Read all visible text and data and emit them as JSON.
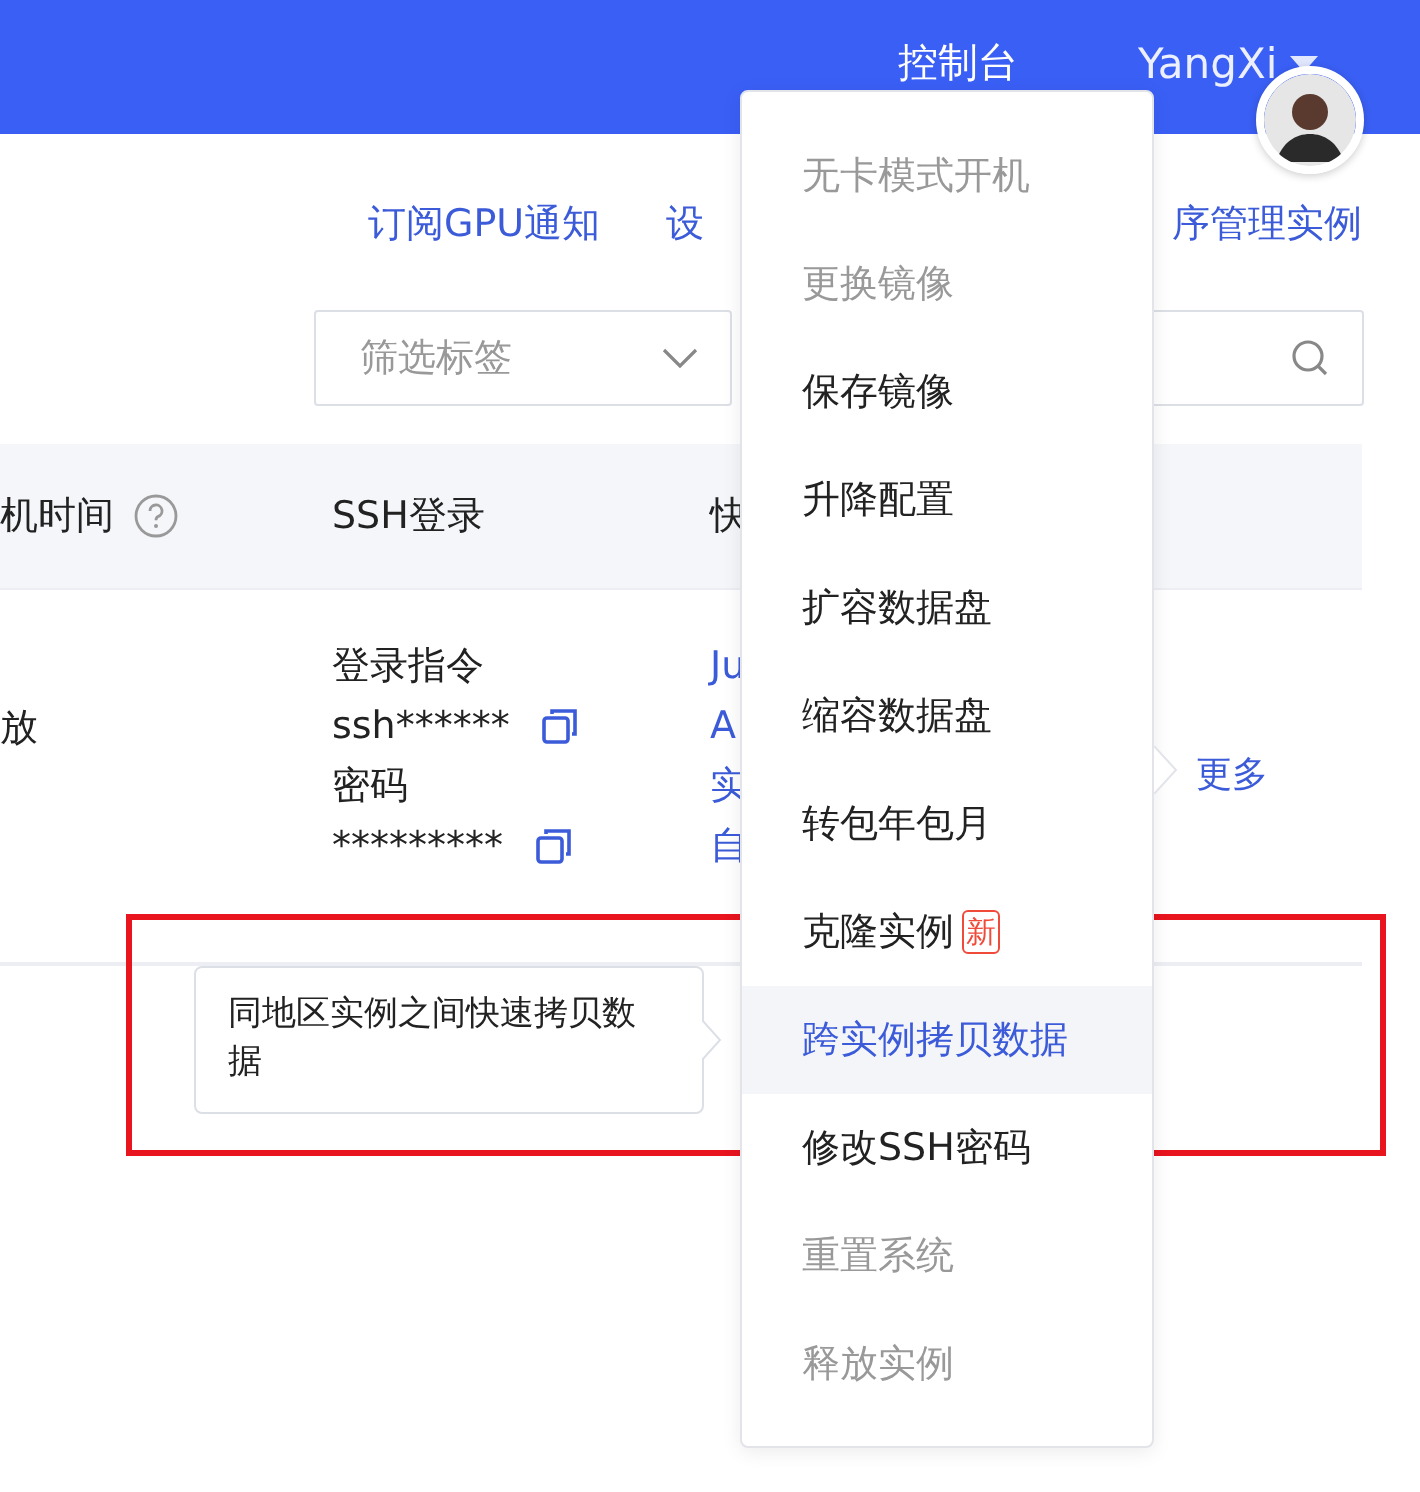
{
  "header": {
    "title": "控制台",
    "user": "YangXi"
  },
  "links": [
    {
      "label": "订阅GPU通知"
    },
    {
      "label": "设"
    },
    {
      "label": "序管理实例"
    }
  ],
  "filter_select": {
    "placeholder": "筛选标签"
  },
  "table": {
    "columns": [
      {
        "label": "机时间",
        "help": true
      },
      {
        "label": "SSH登录"
      },
      {
        "label": "快"
      }
    ],
    "rows": [
      {
        "status": "放",
        "ssh_command_label": "登录指令",
        "ssh_command": "ssh******",
        "password_label": "密码",
        "password": "*********",
        "quick_links": [
          "Ju",
          "A",
          "实",
          "自"
        ],
        "more": "更多"
      }
    ]
  },
  "menu": {
    "items": [
      {
        "label": "无卡模式开机",
        "disabled": true,
        "selected": false
      },
      {
        "label": "更换镜像",
        "disabled": true,
        "selected": false
      },
      {
        "label": "保存镜像",
        "disabled": false,
        "selected": false
      },
      {
        "label": "升降配置",
        "disabled": false,
        "selected": false
      },
      {
        "label": "扩容数据盘",
        "disabled": false,
        "selected": false
      },
      {
        "label": "缩容数据盘",
        "disabled": false,
        "selected": false
      },
      {
        "label": "转包年包月",
        "disabled": false,
        "selected": false
      },
      {
        "label": "克隆实例",
        "disabled": false,
        "selected": false,
        "badge": "新"
      },
      {
        "label": "跨实例拷贝数据",
        "disabled": false,
        "selected": true
      },
      {
        "label": "修改SSH密码",
        "disabled": false,
        "selected": false
      },
      {
        "label": "重置系统",
        "disabled": true,
        "selected": false
      },
      {
        "label": "释放实例",
        "disabled": true,
        "selected": false
      }
    ]
  },
  "tooltip": {
    "text": "同地区实例之间快速拷贝数据"
  }
}
